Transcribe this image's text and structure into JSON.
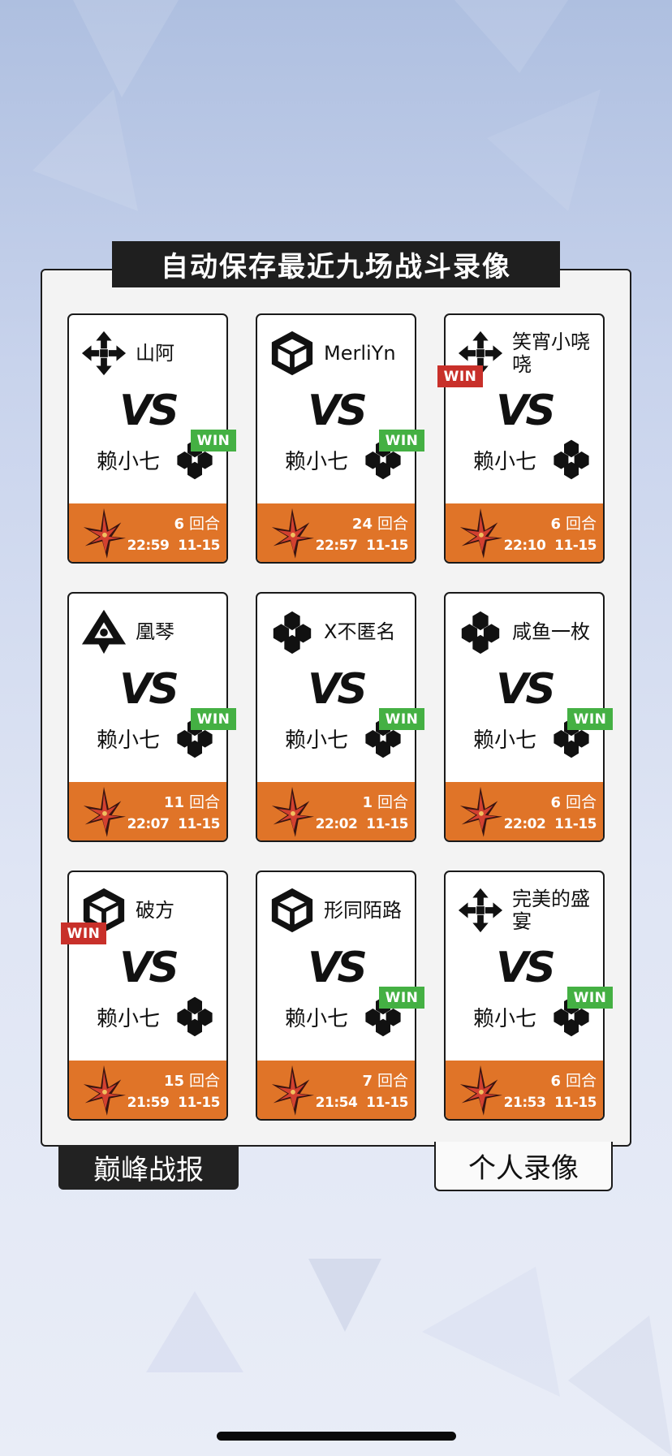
{
  "header": {
    "title": "自动保存最近九场战斗录像"
  },
  "vs_label": "VS",
  "self_player": "赖小七",
  "round_unit": "回合",
  "win_label": "WIN",
  "colors": {
    "card_footer": "#e07428",
    "win_green": "#44b043",
    "win_red": "#c8302a",
    "dark": "#1f1f1f"
  },
  "matches": [
    {
      "opponent": "山阿",
      "opponent_icon": "cross-arrows-icon",
      "self_icon": "hex-cluster-icon",
      "rounds": "6",
      "time": "22:59",
      "date": "11-15",
      "winner": "self"
    },
    {
      "opponent": "MerliYn",
      "opponent_icon": "cube-icon",
      "self_icon": "hex-cluster-icon",
      "rounds": "24",
      "time": "22:57",
      "date": "11-15",
      "winner": "self"
    },
    {
      "opponent": "笑宵小哓哓",
      "opponent_icon": "cross-arrows-icon",
      "self_icon": "hex-cluster-icon",
      "rounds": "6",
      "time": "22:10",
      "date": "11-15",
      "winner": "opponent"
    },
    {
      "opponent": "凰琴",
      "opponent_icon": "triangle-star-icon",
      "self_icon": "hex-cluster-icon",
      "rounds": "11",
      "time": "22:07",
      "date": "11-15",
      "winner": "self"
    },
    {
      "opponent": "X不匿名",
      "opponent_icon": "hex-cluster-icon",
      "self_icon": "hex-cluster-icon",
      "rounds": "1",
      "time": "22:02",
      "date": "11-15",
      "winner": "self"
    },
    {
      "opponent": "咸鱼一枚",
      "opponent_icon": "hex-cluster-icon",
      "self_icon": "hex-cluster-icon",
      "rounds": "6",
      "time": "22:02",
      "date": "11-15",
      "winner": "self"
    },
    {
      "opponent": "破方",
      "opponent_icon": "cube-icon",
      "self_icon": "hex-cluster-icon",
      "rounds": "15",
      "time": "21:59",
      "date": "11-15",
      "winner": "opponent"
    },
    {
      "opponent": "形同陌路",
      "opponent_icon": "cube-icon",
      "self_icon": "hex-cluster-icon",
      "rounds": "7",
      "time": "21:54",
      "date": "11-15",
      "winner": "self"
    },
    {
      "opponent": "完美的盛宴",
      "opponent_icon": "cross-arrows-icon",
      "self_icon": "hex-cluster-icon",
      "rounds": "6",
      "time": "21:53",
      "date": "11-15",
      "winner": "self"
    }
  ],
  "tabs": {
    "left": "巅峰战报",
    "right": "个人录像"
  }
}
